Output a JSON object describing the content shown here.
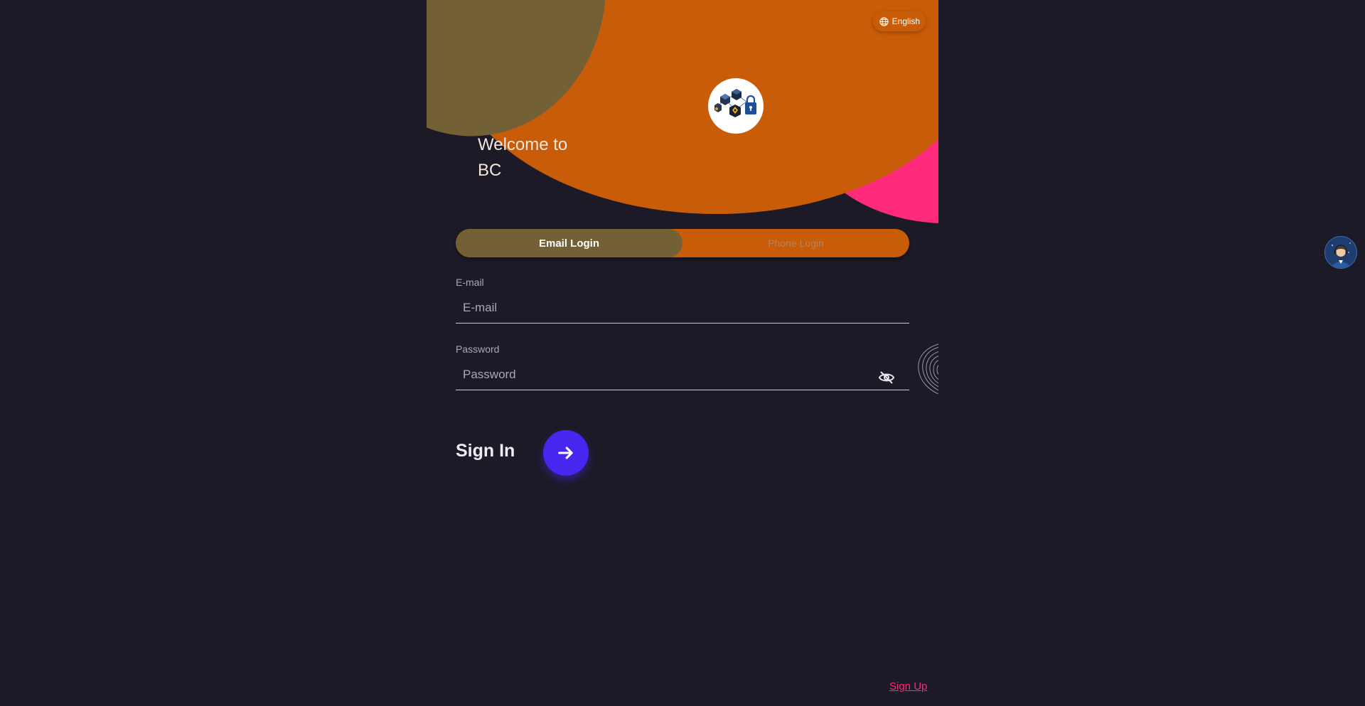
{
  "header": {
    "language_label": "English",
    "welcome_line1": "Welcome to",
    "welcome_line2": "BC"
  },
  "tabs": [
    {
      "label": "Email Login",
      "active": true
    },
    {
      "label": "Phone Login",
      "active": false
    }
  ],
  "email_field": {
    "label": "E-mail",
    "placeholder": "E-mail",
    "value": ""
  },
  "password_field": {
    "label": "Password",
    "placeholder": "Password",
    "value": ""
  },
  "sign_in": {
    "label": "Sign In"
  },
  "footer": {
    "sign_up_label": "Sign Up"
  },
  "colors": {
    "background": "#1c1a26",
    "orange": "#c95c08",
    "olive": "#746035",
    "pink": "#ff2b7a",
    "primary_button": "#4627f0"
  },
  "icons": {
    "language": "globe-icon",
    "password_visibility": "eye-off-icon",
    "sign_in": "arrow-right-icon",
    "biometric": "fingerprint-icon"
  }
}
